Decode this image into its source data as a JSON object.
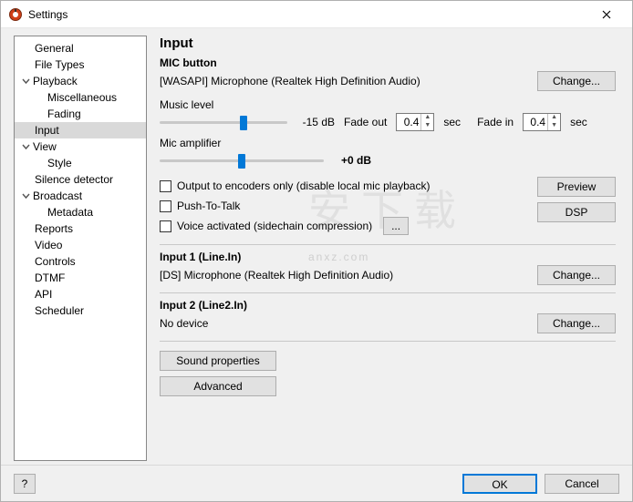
{
  "window": {
    "title": "Settings"
  },
  "sidebar": {
    "items": [
      {
        "label": "General",
        "level": 0
      },
      {
        "label": "File Types",
        "level": 0
      },
      {
        "label": "Playback",
        "level": 0,
        "expandable": true
      },
      {
        "label": "Miscellaneous",
        "level": 1
      },
      {
        "label": "Fading",
        "level": 1
      },
      {
        "label": "Input",
        "level": 0,
        "selected": true
      },
      {
        "label": "View",
        "level": 0,
        "expandable": true
      },
      {
        "label": "Style",
        "level": 1
      },
      {
        "label": "Silence detector",
        "level": 0
      },
      {
        "label": "Broadcast",
        "level": 0,
        "expandable": true
      },
      {
        "label": "Metadata",
        "level": 1
      },
      {
        "label": "Reports",
        "level": 0
      },
      {
        "label": "Video",
        "level": 0
      },
      {
        "label": "Controls",
        "level": 0
      },
      {
        "label": "DTMF",
        "level": 0
      },
      {
        "label": "API",
        "level": 0
      },
      {
        "label": "Scheduler",
        "level": 0
      }
    ]
  },
  "main": {
    "heading": "Input",
    "mic": {
      "title": "MIC button",
      "device": "[WASAPI] Microphone (Realtek High Definition Audio)",
      "change": "Change...",
      "music_level_label": "Music level",
      "music_level_value": "-15 dB",
      "fade_out_label": "Fade out",
      "fade_out_value": "0.4",
      "fade_out_unit": "sec",
      "fade_in_label": "Fade in",
      "fade_in_value": "0.4",
      "fade_in_unit": "sec",
      "mic_amp_label": "Mic amplifier",
      "mic_amp_value": "+0 dB",
      "chk_output": "Output to encoders only (disable local mic playback)",
      "chk_ptt": "Push-To-Talk",
      "chk_voice": "Voice activated (sidechain compression)",
      "ellipsis": "...",
      "preview": "Preview",
      "dsp": "DSP"
    },
    "input1": {
      "title": "Input 1 (Line.In)",
      "device": "[DS] Microphone (Realtek High Definition Audio)",
      "change": "Change..."
    },
    "input2": {
      "title": "Input 2 (Line2.In)",
      "device": "No device",
      "change": "Change..."
    },
    "sound_props": "Sound properties",
    "advanced": "Advanced"
  },
  "footer": {
    "help": "?",
    "ok": "OK",
    "cancel": "Cancel"
  },
  "watermark": {
    "zh": "安下载",
    "en": "anxz.com"
  }
}
